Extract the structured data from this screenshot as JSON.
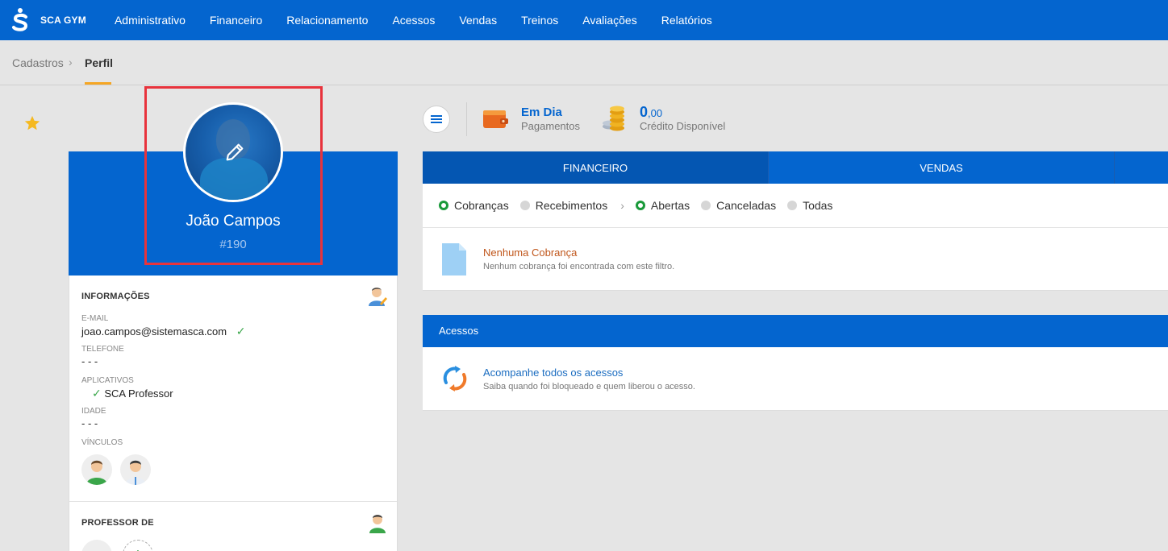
{
  "app": {
    "name": "SCA GYM"
  },
  "nav": {
    "items": [
      "Administrativo",
      "Financeiro",
      "Relacionamento",
      "Acessos",
      "Vendas",
      "Treinos",
      "Avaliações",
      "Relatórios"
    ]
  },
  "breadcrumb": {
    "parent": "Cadastros",
    "current": "Perfil"
  },
  "profile": {
    "name": "João Campos",
    "id": "#190"
  },
  "info": {
    "title": "INFORMAÇÕES",
    "email_label": "E-MAIL",
    "email": "joao.campos@sistemasca.com",
    "phone_label": "TELEFONE",
    "phone": "- - -",
    "apps_label": "APLICATIVOS",
    "app": "SCA Professor",
    "age_label": "IDADE",
    "age": "- - -",
    "links_label": "VÍNCULOS"
  },
  "professor": {
    "title": "PROFESSOR DE"
  },
  "status": {
    "payment_title": "Em Dia",
    "payment_sub": "Pagamentos",
    "credit_int": "0",
    "credit_dec": ",00",
    "credit_sub": "Crédito Disponível"
  },
  "tabs": [
    {
      "label": "FINANCEIRO",
      "active": true
    },
    {
      "label": "VENDAS",
      "active": false
    }
  ],
  "filters": {
    "type": [
      {
        "label": "Cobranças",
        "on": true
      },
      {
        "label": "Recebimentos",
        "on": false
      }
    ],
    "status": [
      {
        "label": "Abertas",
        "on": true
      },
      {
        "label": "Canceladas",
        "on": false
      },
      {
        "label": "Todas",
        "on": false
      }
    ]
  },
  "empty": {
    "title": "Nenhuma Cobrança",
    "sub": "Nenhum cobrança foi encontrada com este filtro."
  },
  "access": {
    "header": "Acessos",
    "title": "Acompanhe todos os acessos",
    "sub": "Saiba quando foi bloqueado e quem liberou o acesso."
  },
  "colors": {
    "primary": "#0465cf",
    "accent": "#f5a623",
    "success": "#1a9a3a",
    "highlight": "#e8333c"
  }
}
